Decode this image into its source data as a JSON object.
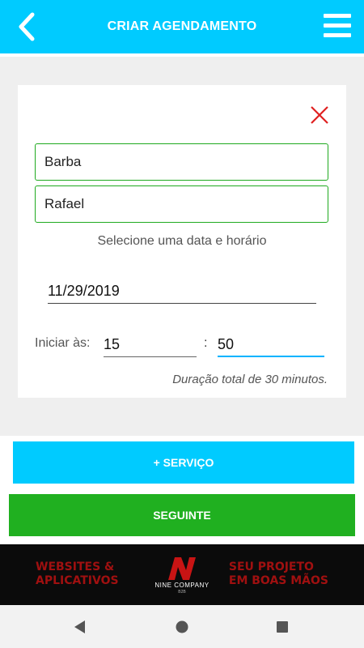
{
  "header": {
    "title": "CRIAR AGENDAMENTO",
    "color": "#00cbff",
    "back_icon": "back-chevron-icon",
    "menu_icon": "hamburger-menu-icon"
  },
  "card": {
    "close_icon": "close-x-icon",
    "service_value": "Barba",
    "client_value": "Rafael",
    "hint": "Selecione uma data e horário",
    "date_value": "11/29/2019",
    "start_label": "Iniciar às:",
    "hour_value": "15",
    "separator": ":",
    "minute_value": "50",
    "duration_text": "Duração total de 30 minutos."
  },
  "actions": {
    "add_service_label": "+ SERVIÇO",
    "next_label": "SEGUINTE",
    "add_service_color": "#00cbff",
    "next_color": "#20b020"
  },
  "banner": {
    "left_line1": "WEBSITES &",
    "left_line2": "APLICATIVOS",
    "logo_text": "NINE COMPANY",
    "logo_sub": "B2B",
    "right_line1": "SEU PROJETO",
    "right_line2": "EM BOAS MÃOS"
  },
  "system_nav": {
    "back_icon": "nav-back-triangle-icon",
    "home_icon": "nav-home-circle-icon",
    "recents_icon": "nav-recents-square-icon"
  }
}
